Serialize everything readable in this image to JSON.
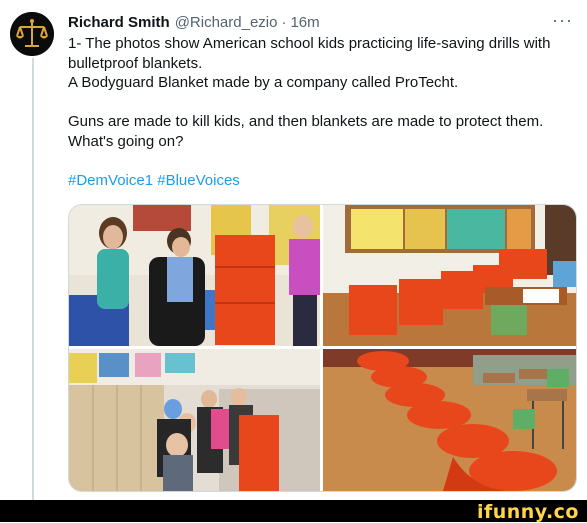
{
  "tweet": {
    "author_name": "Richard Smith",
    "handle": "@Richard_ezio",
    "separator": "·",
    "time": "16m",
    "more_label": "···",
    "lines": {
      "l1": "1- The photos show American school kids practicing life-saving drills with bulletproof blankets.",
      "l2": "A Bodyguard Blanket made by a company called ProTecht.",
      "l3": "Guns are made to kill kids, and then blankets are made to protect them. What's going on?"
    },
    "hashtags": [
      "#DemVoice1",
      "#BlueVoices"
    ]
  },
  "media": {
    "photos": [
      {
        "name": "teacher-fitting-blanket-on-boy"
      },
      {
        "name": "orange-blankets-along-classroom-wall"
      },
      {
        "name": "kids-in-hallway-wearing-blankets"
      },
      {
        "name": "kids-crouched-under-blankets-in-classroom"
      }
    ]
  },
  "watermark": {
    "text": "ifunny.co"
  },
  "colors": {
    "link": "#1d9bf0",
    "text": "#0f1419",
    "muted": "#536471",
    "blanket_orange": "#e8461b",
    "watermark_yellow": "#ffd54a"
  }
}
